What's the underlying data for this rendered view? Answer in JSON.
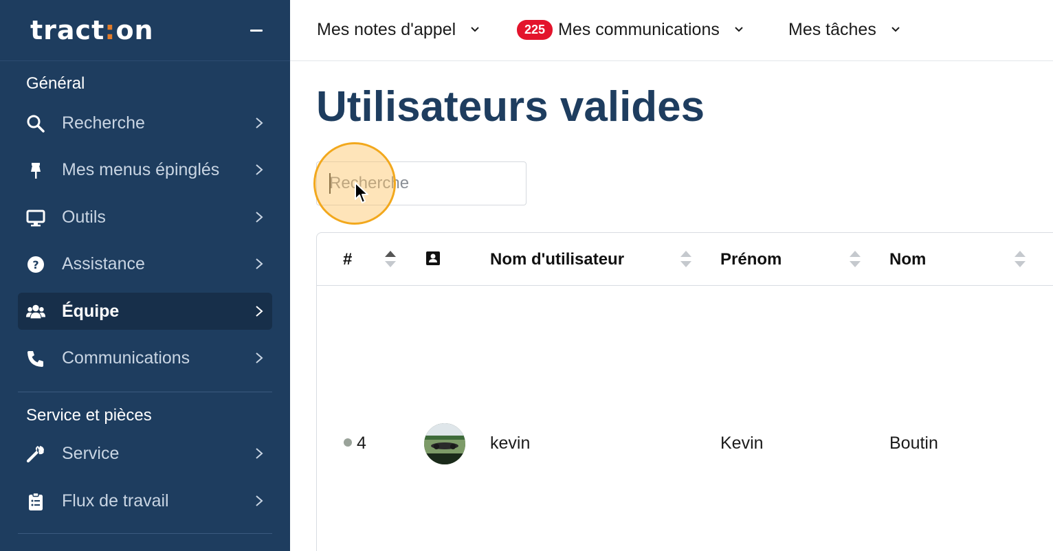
{
  "app": {
    "logo_text_a": "tract",
    "logo_text_b": "on"
  },
  "sidebar": {
    "sections": [
      {
        "title": "Général"
      },
      {
        "title": "Service et pièces"
      }
    ],
    "items": [
      {
        "label": "Recherche",
        "icon": "search-icon"
      },
      {
        "label": "Mes menus épinglés",
        "icon": "pin-icon"
      },
      {
        "label": "Outils",
        "icon": "monitor-icon"
      },
      {
        "label": "Assistance",
        "icon": "question-icon"
      },
      {
        "label": "Équipe",
        "icon": "team-icon",
        "active": true
      },
      {
        "label": "Communications",
        "icon": "phone-icon"
      },
      {
        "label": "Service",
        "icon": "wrench-icon"
      },
      {
        "label": "Flux de travail",
        "icon": "clipboard-icon"
      }
    ]
  },
  "topbar": {
    "notes_label": "Mes notes d'appel",
    "communications_badge": "225",
    "communications_label": "Mes communications",
    "tasks_label": "Mes tâches"
  },
  "main": {
    "title": "Utilisateurs valides",
    "search_placeholder": "Recherche"
  },
  "table": {
    "headers": {
      "id": "#",
      "username": "Nom d'utilisateur",
      "first_name": "Prénom",
      "last_name": "Nom"
    },
    "rows": [
      {
        "id": "4",
        "username": "kevin",
        "first_name": "Kevin",
        "last_name": "Boutin"
      }
    ]
  },
  "colors": {
    "sidebar_bg": "#1e3d5f",
    "accent_orange": "#e07b2a",
    "badge_red": "#e3142c",
    "title_blue": "#1e3d5f"
  }
}
